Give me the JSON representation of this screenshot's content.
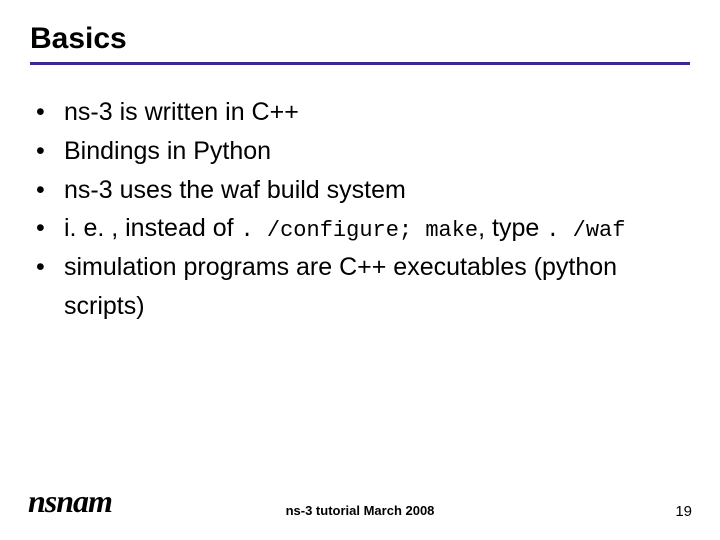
{
  "title": "Basics",
  "bullets": [
    {
      "pre": "ns-3 is written in C++"
    },
    {
      "pre": "Bindings in Python"
    },
    {
      "pre": "ns-3 uses the waf build system"
    },
    {
      "pre": "i. e. , instead of ",
      "code1": ". /configure; make",
      "mid": ", type ",
      "code2": ". /waf"
    },
    {
      "pre": "simulation programs are C++ executables (python scripts)"
    }
  ],
  "footer": {
    "logo": "nsnam",
    "center": "ns-3 tutorial March 2008",
    "page": "19"
  }
}
